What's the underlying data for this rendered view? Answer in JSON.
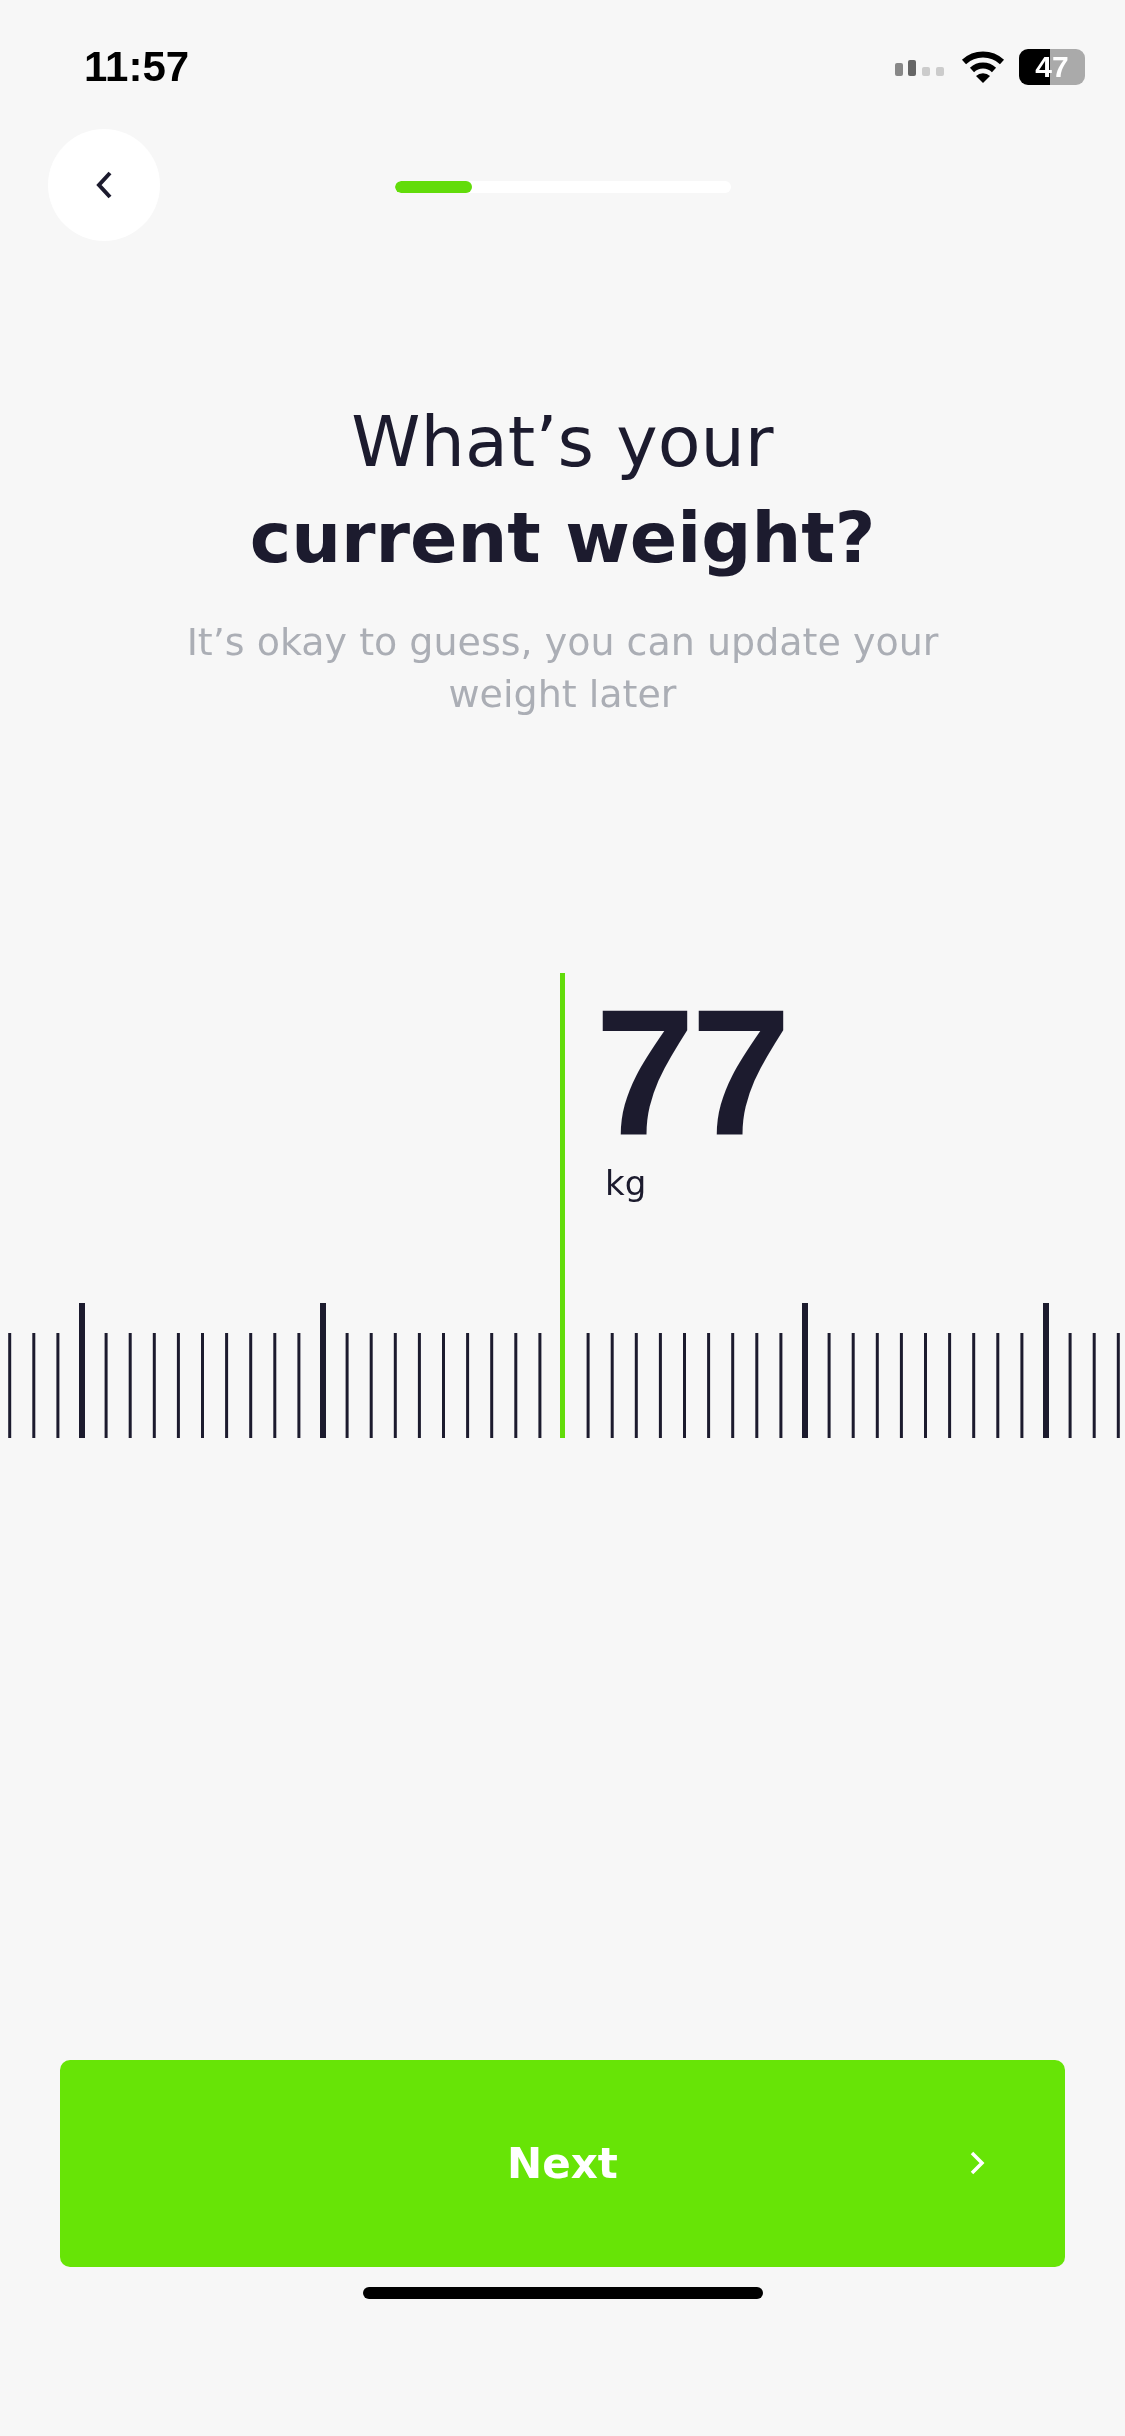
{
  "status_bar": {
    "time": "11:57",
    "battery": "47"
  },
  "header": {
    "progress": {
      "level": 0.23
    }
  },
  "title": "What’s your **current weight?**",
  "subtitle": "It’s okay to guess, you can update your weight later",
  "weight": {
    "value": "77",
    "unit": "kg"
  },
  "next_button": {
    "label": "Next"
  }
}
